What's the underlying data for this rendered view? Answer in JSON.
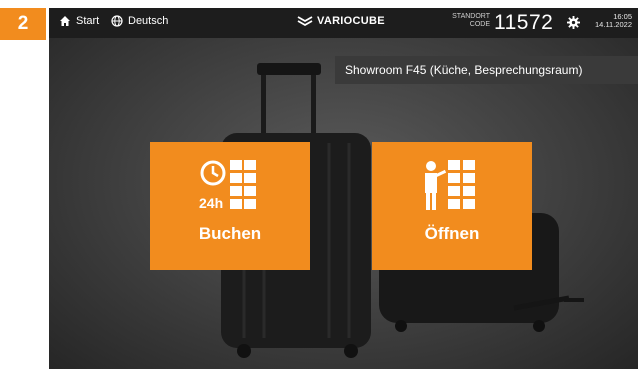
{
  "step_badge": "2",
  "topbar": {
    "start_label": "Start",
    "language_label": "Deutsch",
    "logo_text": "VARIOCUBE",
    "code_label_line1": "STANDORT",
    "code_label_line2": "CODE",
    "code_value": "11572",
    "time": "16:05",
    "date": "14.11.2022",
    "icons": [
      "home-icon",
      "globe-icon",
      "variocube-logo-icon",
      "gear-icon"
    ]
  },
  "location": "Showroom F45 (Küche, Besprechungsraum)",
  "tiles": [
    {
      "label": "Buchen",
      "icon_text": "24h",
      "icon": "clock-lockers-icon"
    },
    {
      "label": "Öffnen",
      "icon": "person-lockers-icon"
    }
  ],
  "colors": {
    "accent": "#f28c1e",
    "topbar": "#1d1d1d",
    "background": "#3e3e3e"
  }
}
